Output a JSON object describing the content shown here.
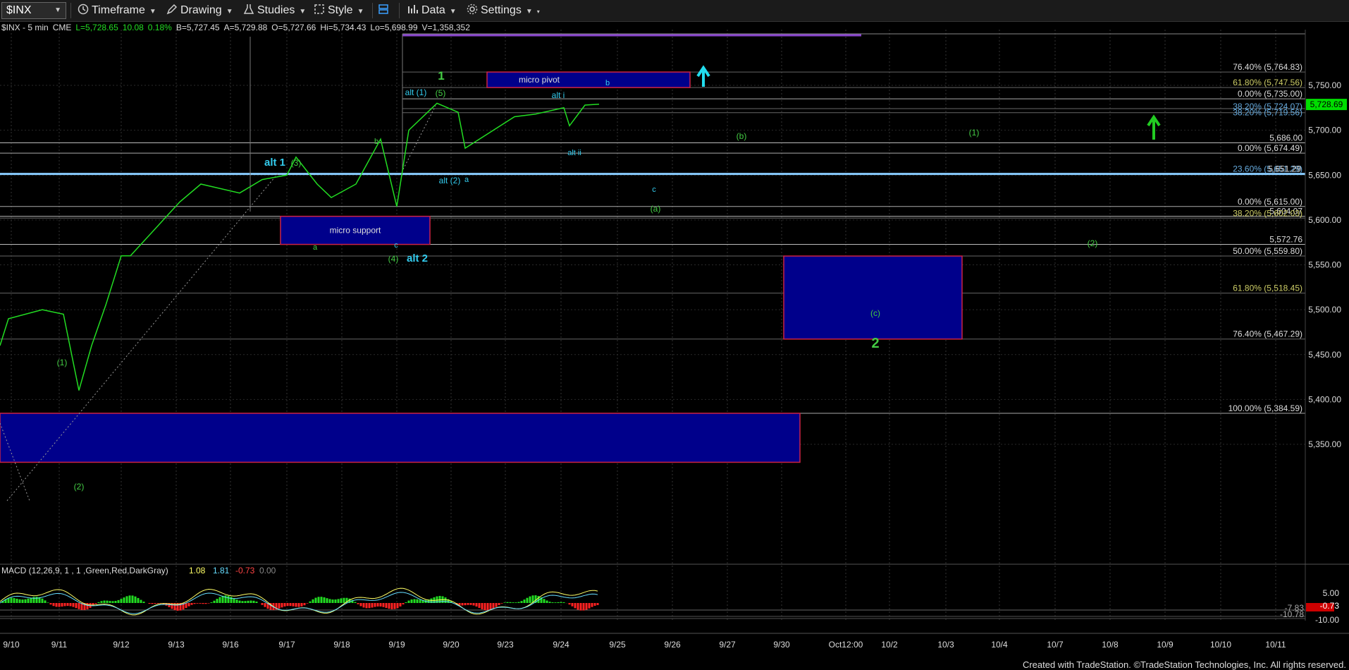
{
  "toolbar": {
    "symbol": "$INX",
    "timeframe": "Timeframe",
    "drawing": "Drawing",
    "studies": "Studies",
    "style": "Style",
    "data": "Data",
    "settings": "Settings"
  },
  "info": {
    "symbol_desc": "$INX - 5 min",
    "exchange": "CME",
    "last": "L=5,728.65",
    "change": "10.08",
    "pct": "0.18%",
    "bid": "B=5,727.45",
    "ask": "A=5,729.88",
    "open": "O=5,727.66",
    "high": "Hi=5,734.43",
    "low": "Lo=5,698.99",
    "volume": "V=1,358,352"
  },
  "colors": {
    "up": "#22dd22",
    "down": "#ff2222",
    "wave_green": "#44cc44",
    "wave_cyan": "#33ccee",
    "box_fill": "#00008b",
    "box_border": "#cc2244",
    "price_label_bg": "#00dd00"
  },
  "chart_data": {
    "type": "line",
    "title": "",
    "xlabel": "",
    "ylabel": "",
    "ylim": [
      5300,
      5790
    ],
    "x_ticks": [
      "9/10",
      "9/11",
      "9/12",
      "9/13",
      "9/16",
      "9/17",
      "9/18",
      "9/19",
      "9/20",
      "9/23",
      "9/24",
      "9/25",
      "9/26",
      "9/27",
      "9/30",
      "Oct12:00",
      "10/2",
      "10/3",
      "10/4",
      "10/7",
      "10/8",
      "10/9",
      "10/10",
      "10/11"
    ],
    "y_ticks": [
      "5,750.00",
      "5,700.00",
      "5,650.00",
      "5,600.00",
      "5,550.00",
      "5,500.00",
      "5,450.00",
      "5,400.00",
      "5,350.00"
    ],
    "last_price": "5,728.69",
    "series": [
      {
        "x": [
          "9/10",
          "9/10",
          "9/10",
          "9/11",
          "9/11",
          "9/11",
          "9/11",
          "9/12",
          "9/12",
          "9/12",
          "9/13",
          "9/13",
          "9/16",
          "9/16",
          "9/17",
          "9/17",
          "9/17",
          "9/18",
          "9/18",
          "9/18",
          "9/19",
          "9/19",
          "9/19",
          "9/20",
          "9/20",
          "9/20",
          "9/23",
          "9/23",
          "9/24",
          "9/24",
          "9/24",
          "9/24"
        ],
        "values": [
          5460,
          5490,
          5500,
          5495,
          5410,
          5460,
          5505,
          5560,
          5560,
          5590,
          5620,
          5640,
          5630,
          5645,
          5650,
          5670,
          5640,
          5625,
          5640,
          5690,
          5615,
          5700,
          5730,
          5720,
          5680,
          5700,
          5715,
          5718,
          5725,
          5705,
          5728,
          5729
        ]
      }
    ],
    "fib_levels": [
      {
        "label": "76.40% (5,764.83)",
        "value": 5764.83
      },
      {
        "label": "61.80% (5,747.56)",
        "value": 5747.56
      },
      {
        "label": "0.00% (5,735.00)",
        "value": 5735.0
      },
      {
        "label": "38.20% (5,724.07)",
        "value": 5724.07
      },
      {
        "label": "38.20% (5,719.56)",
        "value": 5719.56
      },
      {
        "label": "5,686.00",
        "value": 5686.0
      },
      {
        "label": "0.00% (5,674.49)",
        "value": 5674.49
      },
      {
        "label": "23.60% (5,651.29)",
        "value": 5651.29
      },
      {
        "label": "5,651.29",
        "value": 5651.29
      },
      {
        "label": "0.00% (5,615.00)",
        "value": 5615.0
      },
      {
        "label": "5,604.07",
        "value": 5604.07
      },
      {
        "label": "38.20% (5,602.03)",
        "value": 5602.03
      },
      {
        "label": "5,572.76",
        "value": 5572.76
      },
      {
        "label": "50.00% (5,559.80)",
        "value": 5559.8
      },
      {
        "label": "61.80% (5,518.45)",
        "value": 5518.45
      },
      {
        "label": "76.40% (5,467.29)",
        "value": 5467.29
      },
      {
        "label": "100.00% (5,384.59)",
        "value": 5384.59
      }
    ],
    "boxes": [
      {
        "label": "micro pivot",
        "x0": "9/20",
        "x1": "9/26",
        "y0": 5747.56,
        "y1": 5764.83
      },
      {
        "label": "micro support",
        "x0": "9/17",
        "x1": "9/19",
        "y0": 5572.76,
        "y1": 5604.07
      },
      {
        "label": "",
        "x0": "9/30",
        "x1": "10/3",
        "y0": 5467.29,
        "y1": 5559.8
      },
      {
        "label": "",
        "x0": "9/10",
        "x1": "9/30",
        "y0": 5330,
        "y1": 5384.59
      }
    ],
    "annotations": [
      "1",
      "(1)",
      "(2)",
      "(3)",
      "alt 1",
      "a",
      "b",
      "c",
      "(4)",
      "alt 2",
      "alt (1)",
      "(5)",
      "alt (2)",
      "a",
      "alt i",
      "alt ii",
      "b",
      "c",
      "(a)",
      "(b)",
      "(1)",
      "(2)",
      "(c)",
      "2"
    ],
    "macd": {
      "label": "MACD (12,26,9, 1 , 1 ,Green,Red,DarkGray)",
      "macd": "1.08",
      "signal": "1.81",
      "hist": "-0.73",
      "zero": "0.00",
      "y_ticks": [
        "5.00",
        "-0.73",
        "-7.83",
        "-10.78",
        "-10.00"
      ]
    }
  },
  "footer": "Created with TradeStation. ©TradeStation Technologies, Inc. All rights reserved."
}
